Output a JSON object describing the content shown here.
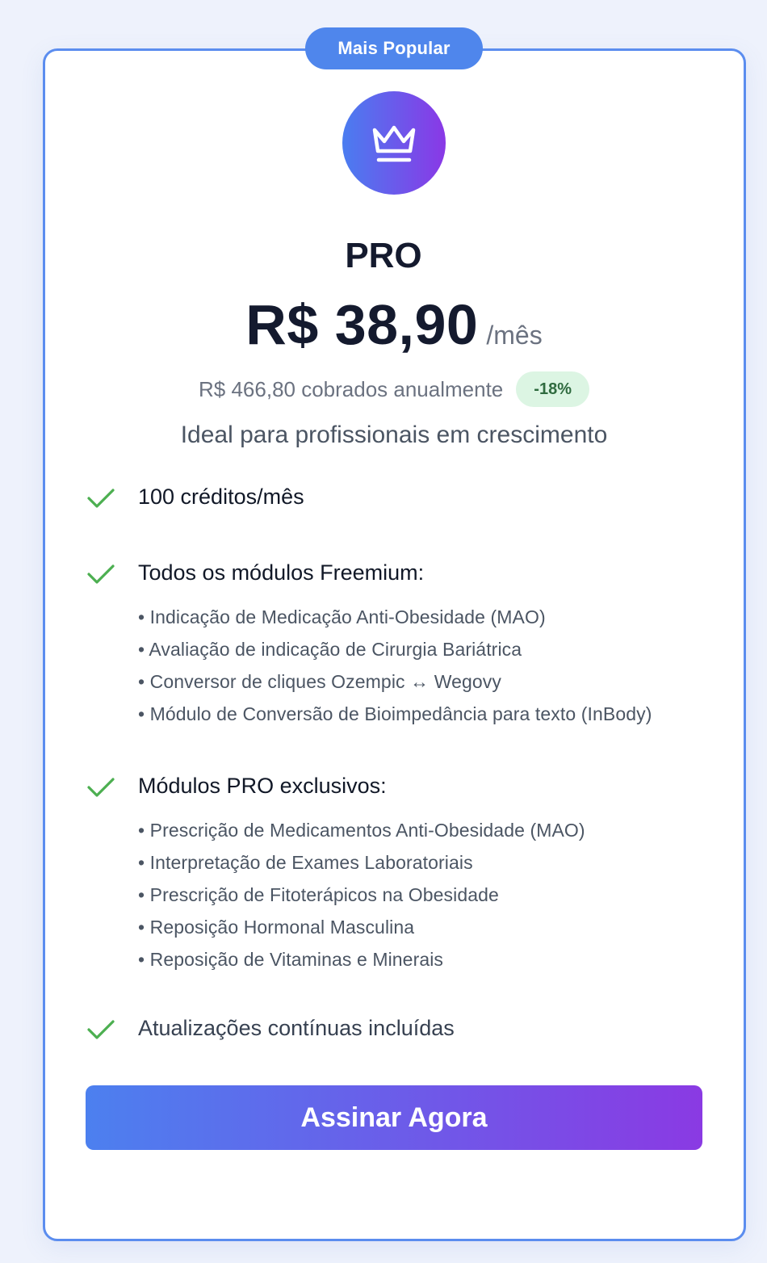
{
  "badge": "Mais Popular",
  "icon": "crown-icon",
  "plan": {
    "name": "PRO",
    "price": "R$ 38,90",
    "period": "/mês",
    "annual_note": "R$ 466,80 cobrados anualmente",
    "discount": "-18%",
    "tagline": "Ideal para profissionais em crescimento"
  },
  "features": [
    {
      "label": "100 créditos/mês"
    },
    {
      "label": "Todos os módulos Freemium:",
      "items": [
        "• Indicação de Medicação Anti-Obesidade (MAO)",
        "• Avaliação de indicação de Cirurgia Bariátrica",
        "• Conversor de cliques Ozempic ↔ Wegovy",
        "• Módulo de Conversão de Bioimpedância para texto (InBody)"
      ]
    },
    {
      "label": "Módulos PRO exclusivos:",
      "items": [
        "• Prescrição de Medicamentos Anti-Obesidade (MAO)",
        "• Interpretação de Exames Laboratoriais",
        "• Prescrição de Fitoterápicos na Obesidade",
        "• Reposição Hormonal Masculina",
        "• Reposição de Vitaminas e Minerais"
      ]
    },
    {
      "label": "Atualizações contínuas incluídas"
    }
  ],
  "cta": {
    "label": "Assinar Agora"
  },
  "colors": {
    "accent": "#4f86ec",
    "gradient_start": "#4c80ef",
    "gradient_end": "#8a3ae3",
    "check": "#4caf50",
    "discount_bg": "#dcf5e3"
  }
}
